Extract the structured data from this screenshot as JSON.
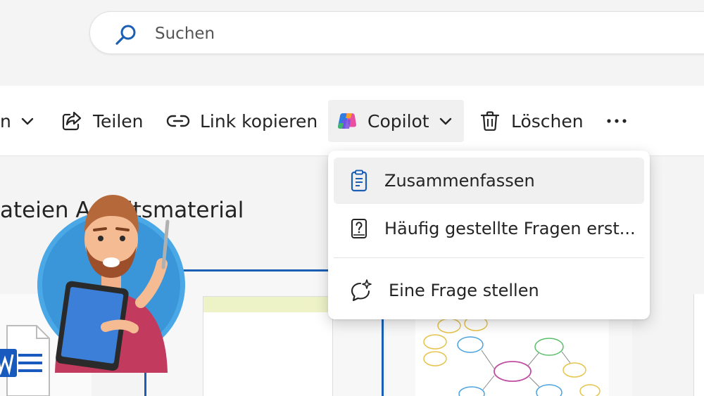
{
  "search": {
    "placeholder": "Suchen"
  },
  "commandbar": {
    "share_label": "Teilen",
    "copy_link_label": "Link kopieren",
    "copilot_label": "Copilot",
    "delete_label": "Löschen",
    "prev_fragment": "n"
  },
  "section": {
    "title": "ateien  Arbeitsmaterial"
  },
  "copilot_menu": {
    "items": [
      {
        "label": "Zusammenfassen",
        "icon": "document-summary-icon"
      },
      {
        "label": "Häufig gestellte Fragen erst...",
        "icon": "question-document-icon"
      },
      {
        "label": "Eine Frage stellen",
        "icon": "chat-sparkle-icon"
      }
    ]
  },
  "colors": {
    "accent": "#1a5fb4",
    "menu_hover": "#f0f0f0"
  }
}
